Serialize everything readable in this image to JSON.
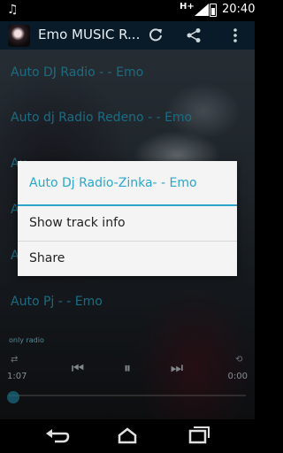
{
  "status": {
    "network": "H+",
    "time": "20:40",
    "icons": [
      "music-note-icon",
      "signal-icon",
      "battery-icon"
    ]
  },
  "appbar": {
    "title": "Emo MUSIC R...",
    "icons": [
      "refresh-icon",
      "share-icon",
      "overflow-menu-icon"
    ]
  },
  "list": {
    "items": [
      "Auto DJ Radio - - Emo",
      "Auto dj Radio Redeno - - Emo",
      "Au",
      "Au",
      "Au",
      "Auto Pj - - Emo"
    ]
  },
  "player": {
    "station": "only radio",
    "elapsed": "1:07",
    "total": "0:00",
    "controls": [
      "previous-icon",
      "pause-icon",
      "next-icon",
      "repeat-icon"
    ]
  },
  "dialog": {
    "title": "Auto Dj Radio-Zinka- - Emo",
    "options": [
      "Show track info",
      "Share"
    ]
  },
  "colors": {
    "accent": "#2aa7c9",
    "appbar": "#0a1e2d",
    "dialog_bg": "#f4f4f4"
  }
}
